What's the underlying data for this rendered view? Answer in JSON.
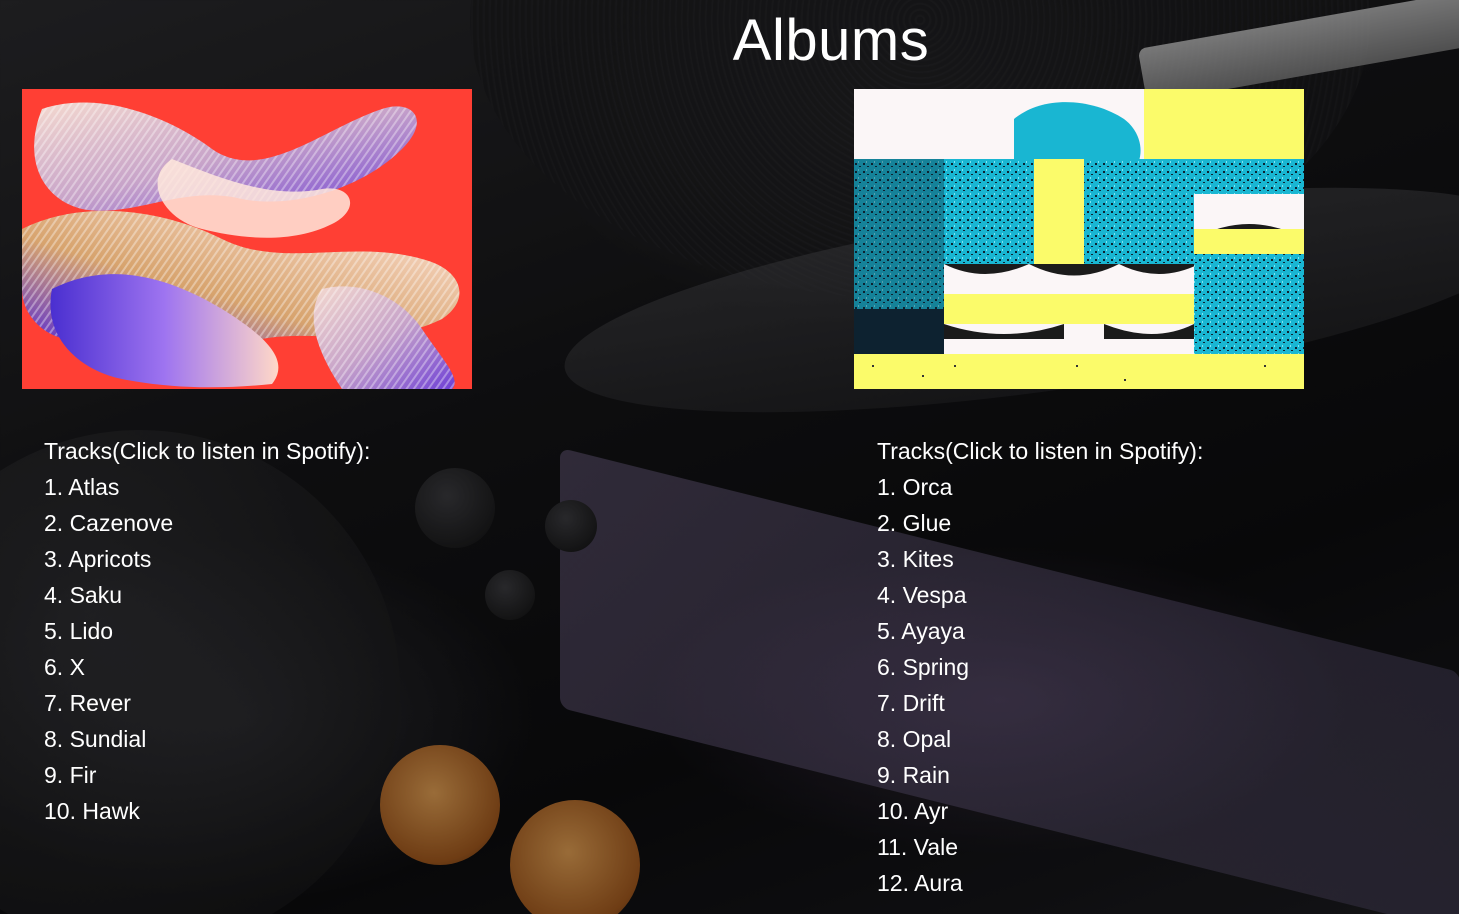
{
  "page": {
    "title": "Albums"
  },
  "albums": [
    {
      "cover_icon": "album-cover-art",
      "tracks_heading": "Tracks(Click to listen in Spotify):",
      "tracks": [
        "1. Atlas",
        "2. Cazenove",
        "3. Apricots",
        "4. Saku",
        "5. Lido",
        "6. X",
        "7. Rever",
        "8. Sundial",
        "9. Fir",
        "10. Hawk"
      ]
    },
    {
      "cover_icon": "album-cover-art",
      "tracks_heading": "Tracks(Click to listen in Spotify):",
      "tracks": [
        "1. Orca",
        "2. Glue",
        "3. Kites",
        "4. Vespa",
        "5. Ayaya",
        "6. Spring",
        "7. Drift",
        "8. Opal",
        "9. Rain",
        "10. Ayr",
        "11. Vale",
        "12. Aura"
      ]
    }
  ],
  "colors": {
    "text": "#ffffff",
    "cover_left_background": "#ff3f34",
    "cover_right_cyan": "#19b6d2",
    "cover_right_yellow": "#fbfb6a"
  }
}
